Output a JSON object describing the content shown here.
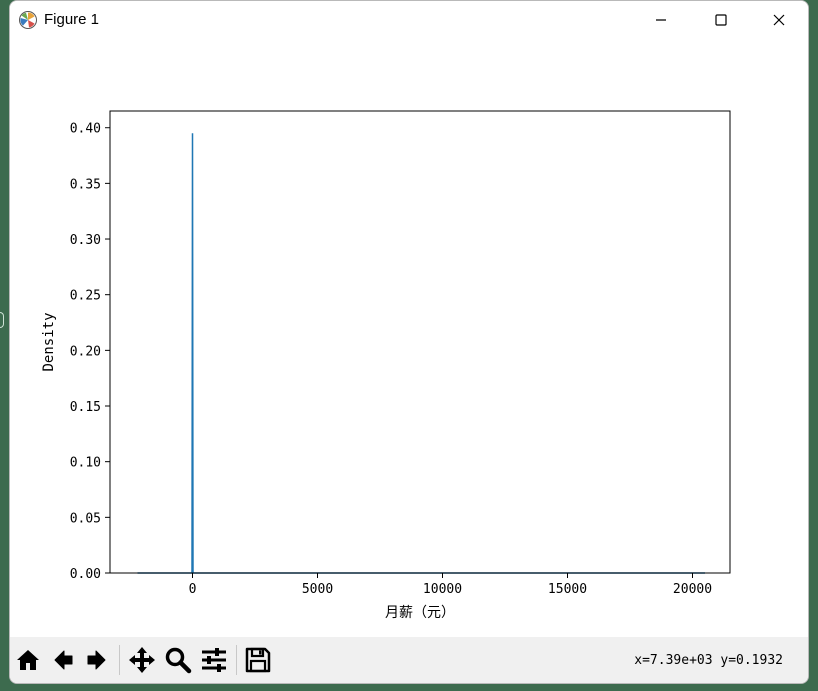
{
  "window": {
    "title": "Figure 1"
  },
  "toolbar": {
    "coords_text": "x=7.39e+03 y=0.1932"
  },
  "icons": {
    "app": "matplotlib-icon",
    "minimize": "minimize-icon",
    "maximize": "maximize-icon",
    "close": "close-icon",
    "home": "home-icon",
    "back": "back-arrow-icon",
    "forward": "forward-arrow-icon",
    "pan": "pan-move-icon",
    "zoom": "zoom-magnifier-icon",
    "configure": "configure-sliders-icon",
    "save": "save-floppy-icon"
  },
  "colors": {
    "series": "#1f77b4",
    "toolbar_bg": "#f0f0f0"
  },
  "chart_data": {
    "type": "line",
    "xlabel": "月薪（元）",
    "ylabel": "Density",
    "xlim": [
      -3300,
      21500
    ],
    "ylim": [
      0.0,
      0.415
    ],
    "xticks": [
      0,
      5000,
      10000,
      15000,
      20000
    ],
    "xtick_labels": [
      "0",
      "5000",
      "10000",
      "15000",
      "20000"
    ],
    "yticks": [
      0.0,
      0.05,
      0.1,
      0.15,
      0.2,
      0.25,
      0.3,
      0.35,
      0.4
    ],
    "ytick_labels": [
      "0.00",
      "0.05",
      "0.10",
      "0.15",
      "0.20",
      "0.25",
      "0.30",
      "0.35",
      "0.40"
    ],
    "grid": false,
    "series": [
      {
        "x": [
          -2200,
          -100,
          -20,
          0,
          20,
          100,
          20500
        ],
        "y": [
          0.0,
          0.0,
          0.0,
          0.395,
          0.0,
          0.0,
          0.0
        ]
      }
    ]
  }
}
